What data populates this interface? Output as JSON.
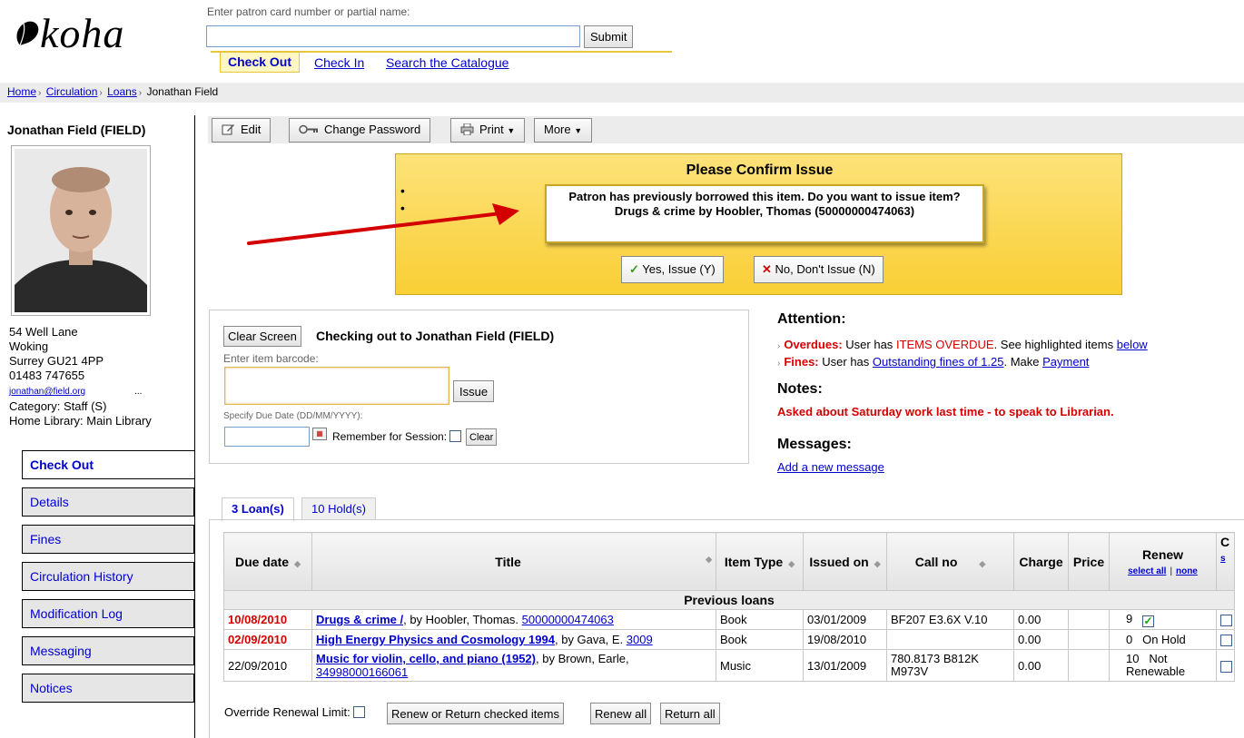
{
  "header": {
    "logo_text": "koha",
    "patron_search_hint": "Enter patron card number or partial name:",
    "patron_search_value": "",
    "submit_label": "Submit",
    "nav": [
      "Check Out",
      "Check In",
      "Search the Catalogue"
    ]
  },
  "breadcrumb": [
    "Home",
    "Circulation",
    "Loans",
    "Jonathan Field"
  ],
  "patron": {
    "name": "Jonathan Field (FIELD)",
    "address1": "54 Well Lane",
    "address2": "Woking",
    "address3": "Surrey GU21 4PP",
    "phone": "01483 747655",
    "email": "jonathan@field.org",
    "email_more": "...",
    "category": "Category: Staff (S)",
    "home_library": "Home Library: Main Library"
  },
  "side_menu": [
    "Check Out",
    "Details",
    "Fines",
    "Circulation History",
    "Modification Log",
    "Messaging",
    "Notices"
  ],
  "toolbar": {
    "edit": "Edit",
    "change_password": "Change Password",
    "print": "Print",
    "more": "More"
  },
  "confirm": {
    "title": "Please Confirm Issue",
    "message_line1": "Patron has previously borrowed this item. Do you want to issue item?",
    "message_line2": "Drugs & crime by Hoobler, Thomas (50000000474063)",
    "yes_label": "Yes, Issue (Y)",
    "no_label": "No, Don't Issue (N)"
  },
  "checkout": {
    "clear_screen": "Clear Screen",
    "title": "Checking out to Jonathan Field (FIELD)",
    "barcode_label": "Enter item barcode:",
    "barcode_value": "",
    "issue_label": "Issue",
    "due_label": "Specify Due Date (DD/MM/YYYY):",
    "due_value": "",
    "remember_label": "Remember for Session:",
    "clear_label": "Clear"
  },
  "attention": {
    "heading": "Attention:",
    "overdues_label": "Overdues:",
    "overdues_text1": "User has",
    "overdues_highlight": "ITEMS OVERDUE",
    "overdues_text2": ". See highlighted items",
    "overdues_link": "below",
    "fines_label": "Fines:",
    "fines_text1": "User has",
    "fines_link": "Outstanding fines of 1.25",
    "fines_text2": ". Make",
    "fines_payment": "Payment",
    "notes_heading": "Notes:",
    "notes_text": "Asked about Saturday work last time - to speak to Librarian.",
    "messages_heading": "Messages:",
    "add_message": "Add a new message"
  },
  "tabs": [
    "3 Loan(s)",
    "10 Hold(s)"
  ],
  "loans_table": {
    "headers": {
      "due_date": "Due date",
      "title": "Title",
      "item_type": "Item Type",
      "issued_on": "Issued on",
      "call_no": "Call no",
      "charge": "Charge",
      "price": "Price",
      "renew": "Renew",
      "select_all": "select all",
      "none": "none",
      "extra": "C",
      "extra_sub": "s"
    },
    "group_label": "Previous loans",
    "rows": [
      {
        "due": "10/08/2010",
        "title": "Drugs & crime /",
        "author": ", by Hoobler, Thomas.",
        "barcode": "50000000474063",
        "type": "Book",
        "issued": "03/01/2009",
        "callno": "BF207 E3.6X V.10",
        "charge": "0.00",
        "price": "",
        "renew_count": "9",
        "renew_status": ""
      },
      {
        "due": "02/09/2010",
        "title": "High Energy Physics and Cosmology 1994",
        "author": ", by Gava, E.",
        "barcode": "3009",
        "type": "Book",
        "issued": "19/08/2010",
        "callno": "",
        "charge": "0.00",
        "price": "",
        "renew_count": "0",
        "renew_status": "On Hold"
      },
      {
        "due": "22/09/2010",
        "title": "Music for violin, cello, and piano (1952)",
        "author": ", by Brown, Earle,",
        "barcode": "34998000166061",
        "type": "Music",
        "issued": "13/01/2009",
        "callno": "780.8173 B812K M973V",
        "charge": "0.00",
        "price": "",
        "renew_count": "10",
        "renew_status": "Not Renewable"
      }
    ]
  },
  "footer_actions": {
    "override_label": "Override Renewal Limit:",
    "renew_or_return": "Renew or Return checked items",
    "renew_all": "Renew all",
    "return_all": "Return all"
  },
  "colors": {
    "accent_yellow": "#fcd94b",
    "link": "#0000cc",
    "overdue_red": "#d60000"
  }
}
